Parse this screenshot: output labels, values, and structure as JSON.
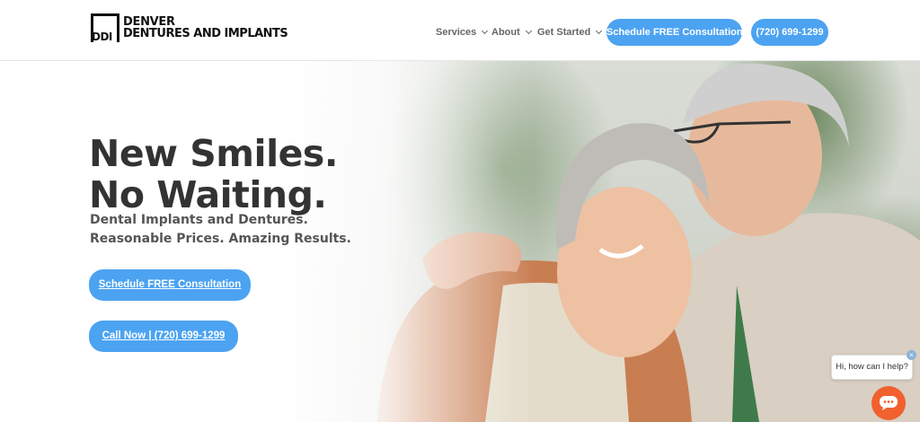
{
  "header": {
    "logo": {
      "mark": "DDI",
      "line1": "DENVER",
      "line2": "DENTURES AND IMPLANTS"
    },
    "nav": [
      {
        "label": "Services"
      },
      {
        "label": "About"
      },
      {
        "label": "Get Started"
      }
    ],
    "cta_consultation": "Schedule FREE Consultation",
    "cta_phone": "(720) 699-1299"
  },
  "hero": {
    "title_line1": "New Smiles.",
    "title_line2": "No Waiting.",
    "subtitle_line1": "Dental Implants and Dentures.",
    "subtitle_line2": "Reasonable Prices. Amazing Results.",
    "button_consultation": "Schedule FREE Consultation",
    "button_call": "Call Now | (720) 699-1299",
    "image_subject": "smiling-senior-couple-photo"
  },
  "chat": {
    "bubble_text": "Hi, how can I help?",
    "close_symbol": "×",
    "button_icon": "chat-icon"
  },
  "colors": {
    "accent": "#4ca3f1",
    "chat": "#f0612f",
    "heading": "#333333"
  }
}
